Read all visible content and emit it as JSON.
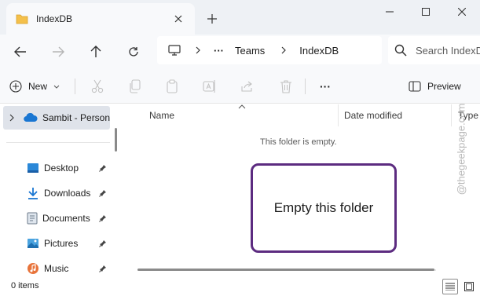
{
  "window": {
    "tab_title": "IndexDB",
    "icons": {
      "folder": "folder-icon",
      "close_tab": "close-icon",
      "new_tab": "plus-icon",
      "minimize": "minimize-icon",
      "maximize": "maximize-icon",
      "close_window": "close-icon"
    }
  },
  "address": {
    "breadcrumbs": [
      "Teams",
      "IndexDB"
    ],
    "overflow": "···",
    "search_placeholder": "Search IndexDB"
  },
  "toolbar": {
    "new_label": "New",
    "preview_label": "Preview",
    "more": "···",
    "icons": [
      "cut-icon",
      "copy-icon",
      "paste-icon",
      "rename-icon",
      "share-icon",
      "delete-icon"
    ]
  },
  "sidebar": {
    "onedrive_label": "Sambit - Person",
    "quick_access": [
      {
        "label": "Desktop",
        "icon": "desktop-icon"
      },
      {
        "label": "Downloads",
        "icon": "download-icon"
      },
      {
        "label": "Documents",
        "icon": "document-icon"
      },
      {
        "label": "Pictures",
        "icon": "pictures-icon"
      },
      {
        "label": "Music",
        "icon": "music-icon"
      }
    ]
  },
  "content": {
    "columns": [
      "Name",
      "Date modified",
      "Type"
    ],
    "empty_message": "This folder is empty.",
    "callout_text": "Empty this folder"
  },
  "watermark": "@thegeekpage.com",
  "status": {
    "item_count": "0 items"
  },
  "colors": {
    "accent": "#0067c0",
    "callout_border": "#5c2b80",
    "folder": "#f4c04b"
  }
}
